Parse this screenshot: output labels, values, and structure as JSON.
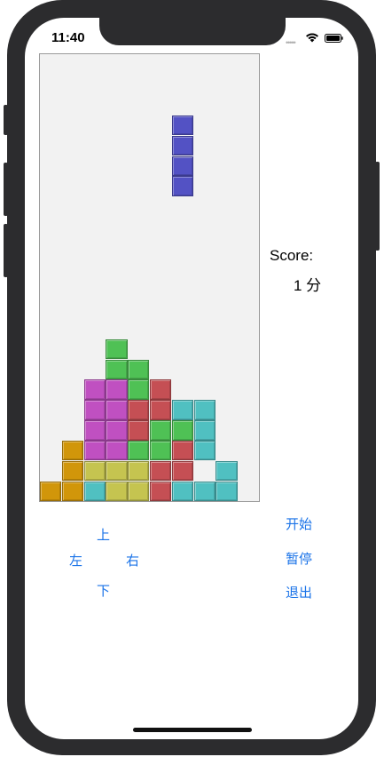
{
  "status_bar": {
    "time": "11:40",
    "signal": "•••••",
    "wifi_icon": "wifi-icon",
    "battery_icon": "battery-icon"
  },
  "game": {
    "score_label": "Score:",
    "score_value": "1 分",
    "colors": {
      "I": "#5352c4",
      "O": "#d1960a",
      "S": "#4fc155",
      "T": "#c050c1",
      "Z": "#c54f54",
      "L": "#c5c450",
      "J": "#50c0c1"
    },
    "active_piece": {
      "type": "I",
      "cells": [
        [
          6,
          3
        ],
        [
          6,
          4
        ],
        [
          6,
          5
        ],
        [
          6,
          6
        ]
      ]
    },
    "stack": [
      [
        3,
        14,
        "S"
      ],
      [
        3,
        15,
        "S"
      ],
      [
        4,
        15,
        "S"
      ],
      [
        2,
        16,
        "T"
      ],
      [
        3,
        16,
        "T"
      ],
      [
        4,
        16,
        "S"
      ],
      [
        5,
        16,
        "Z"
      ],
      [
        2,
        17,
        "T"
      ],
      [
        3,
        17,
        "T"
      ],
      [
        4,
        17,
        "Z"
      ],
      [
        5,
        17,
        "Z"
      ],
      [
        6,
        17,
        "J"
      ],
      [
        7,
        17,
        "J"
      ],
      [
        2,
        18,
        "T"
      ],
      [
        3,
        18,
        "T"
      ],
      [
        4,
        18,
        "Z"
      ],
      [
        5,
        18,
        "S"
      ],
      [
        6,
        18,
        "S"
      ],
      [
        7,
        18,
        "J"
      ],
      [
        1,
        19,
        "O"
      ],
      [
        2,
        19,
        "T"
      ],
      [
        3,
        19,
        "T"
      ],
      [
        4,
        19,
        "S"
      ],
      [
        5,
        19,
        "S"
      ],
      [
        6,
        19,
        "Z"
      ],
      [
        7,
        19,
        "J"
      ],
      [
        1,
        20,
        "O"
      ],
      [
        2,
        20,
        "L"
      ],
      [
        3,
        20,
        "L"
      ],
      [
        4,
        20,
        "L"
      ],
      [
        5,
        20,
        "Z"
      ],
      [
        6,
        20,
        "Z"
      ],
      [
        8,
        20,
        "J"
      ],
      [
        0,
        21,
        "O"
      ],
      [
        1,
        21,
        "O"
      ],
      [
        2,
        21,
        "J"
      ],
      [
        3,
        21,
        "L"
      ],
      [
        4,
        21,
        "L"
      ],
      [
        5,
        21,
        "Z"
      ],
      [
        6,
        21,
        "J"
      ],
      [
        7,
        21,
        "J"
      ],
      [
        8,
        21,
        "J"
      ]
    ]
  },
  "controls": {
    "up": "上",
    "left": "左",
    "right": "右",
    "down": "下",
    "start": "开始",
    "pause": "暂停",
    "quit": "退出"
  }
}
